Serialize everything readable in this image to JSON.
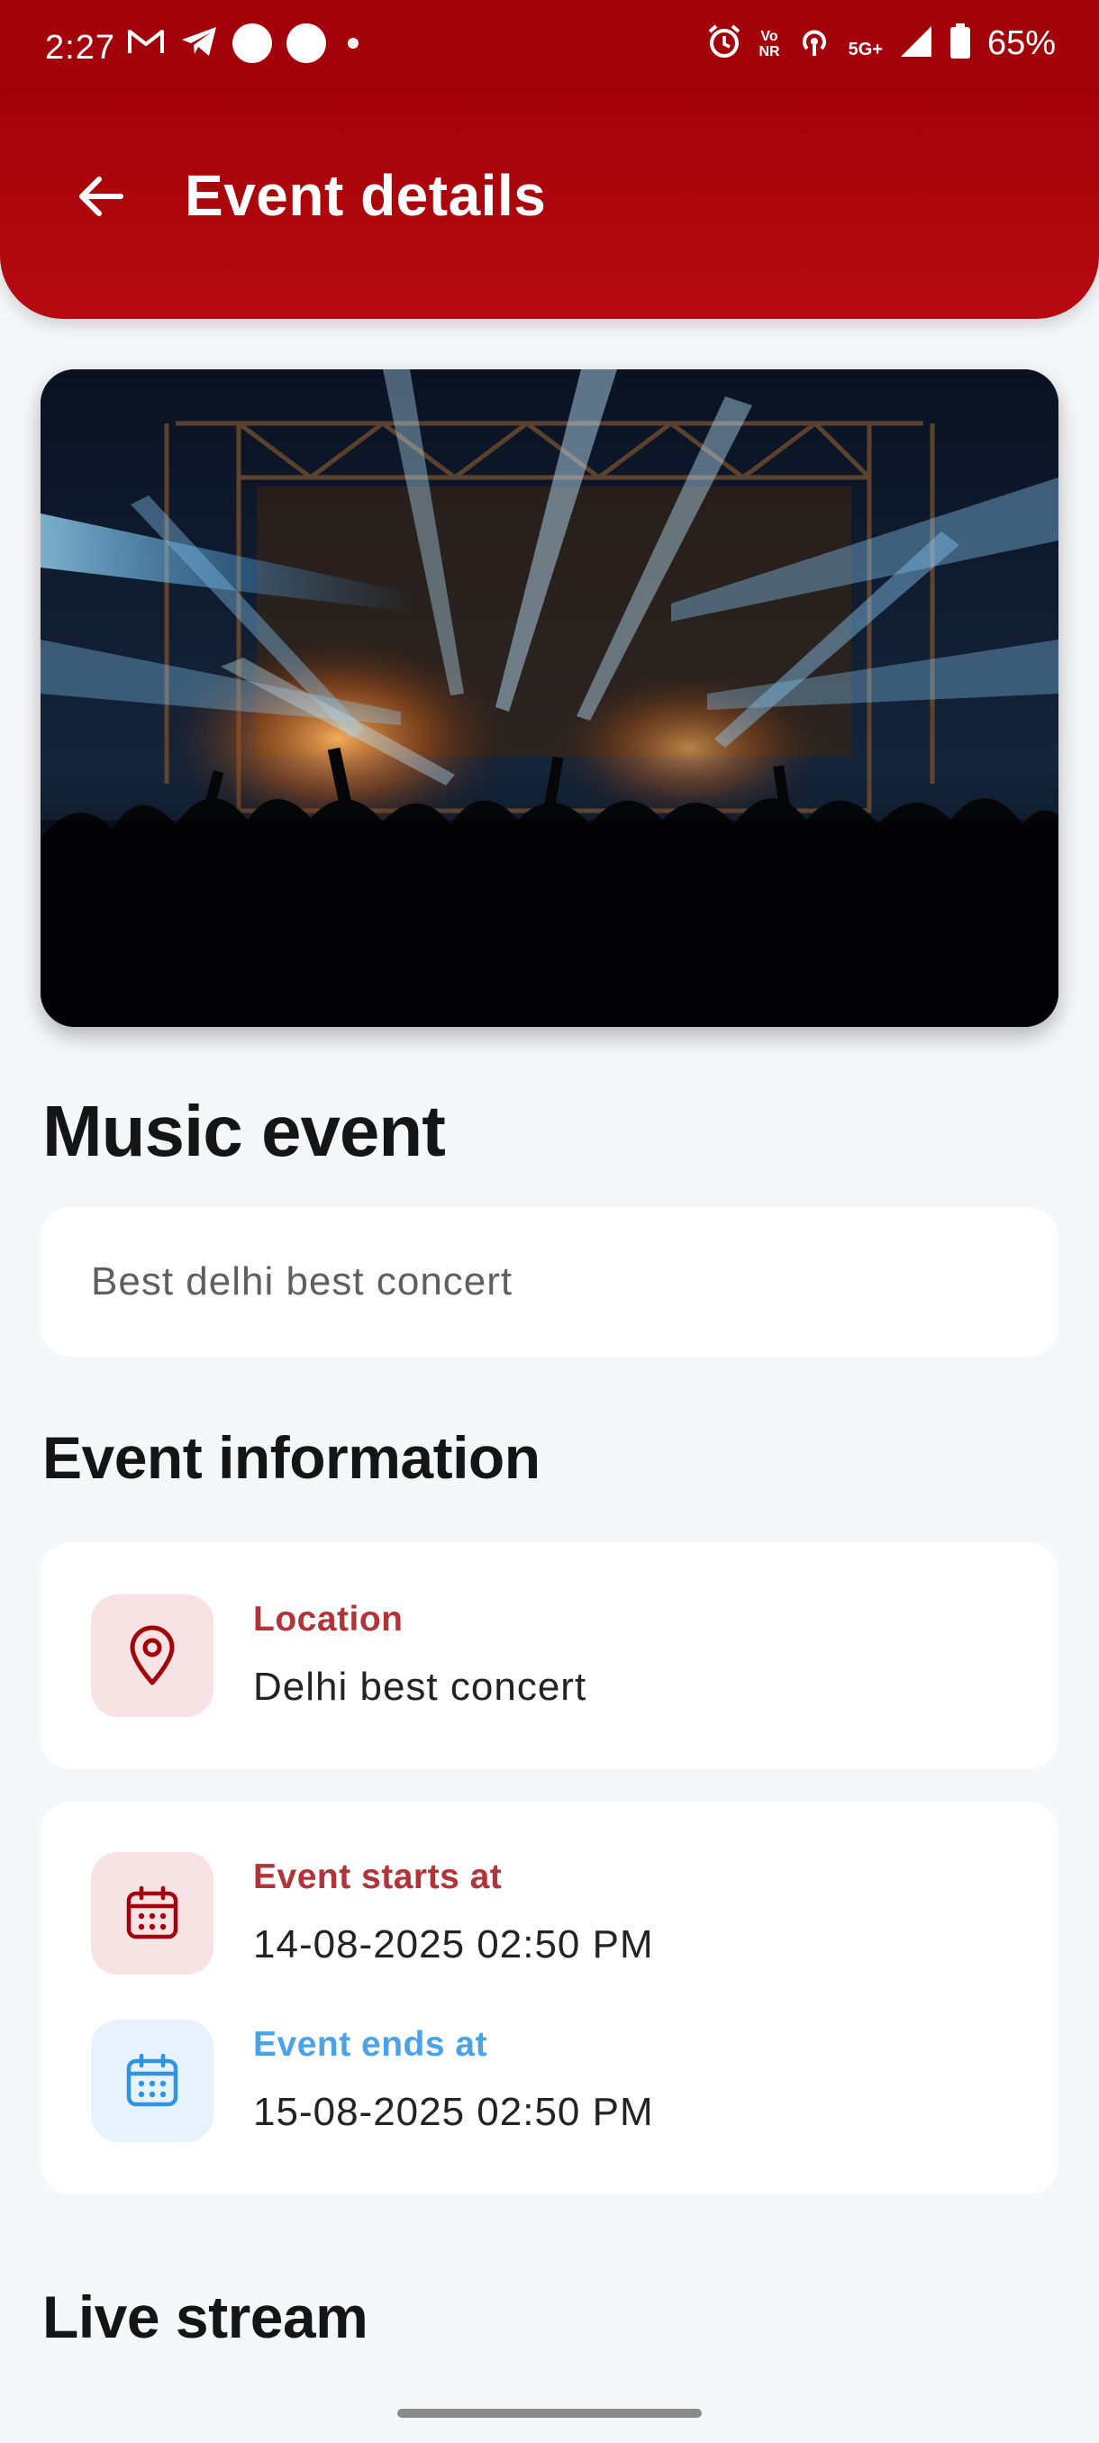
{
  "status_bar": {
    "time": "2:27",
    "battery": "65%",
    "network": "5G+",
    "volte": "Vo",
    "volte_sub": "NR"
  },
  "app_bar": {
    "title": "Event details",
    "back_icon": "arrow-left-icon"
  },
  "event": {
    "title": "Music event",
    "description": "Best delhi best concert"
  },
  "sections": {
    "info_title": "Event information",
    "live_title": "Live stream"
  },
  "location": {
    "label": "Location",
    "value": "Delhi best concert",
    "icon": "map-pin-icon"
  },
  "schedule": {
    "start_label": "Event starts at",
    "start_value": "14-08-2025 02:50 PM",
    "end_label": "Event ends at",
    "end_value": "15-08-2025 02:50 PM"
  },
  "colors": {
    "primary": "#a4020a",
    "accent_red": "#b1343a",
    "accent_blue": "#4aa3e6",
    "background": "#f6f7f9"
  }
}
